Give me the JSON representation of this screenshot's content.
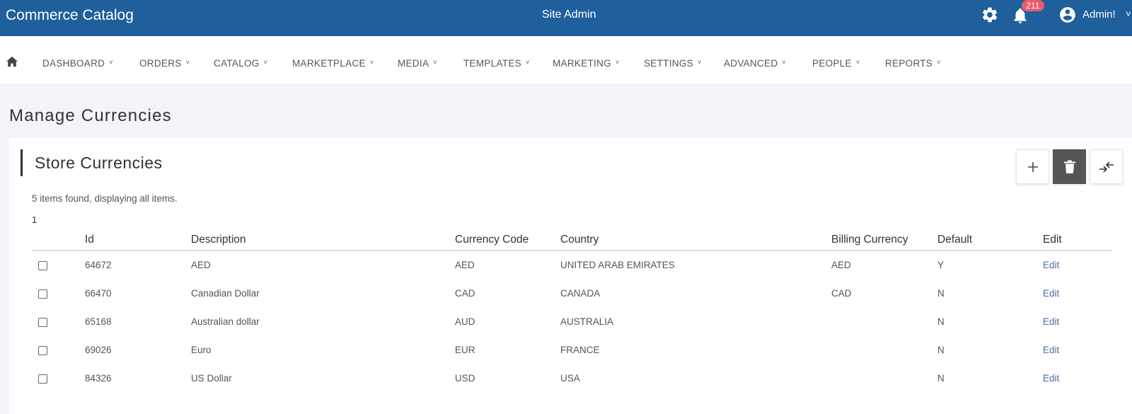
{
  "header": {
    "app_title": "Commerce Catalog",
    "center_title": "Site Admin",
    "notifications_count": "211",
    "user_name": "Admin!",
    "icons": [
      "gear-icon",
      "bell-icon",
      "user-circle-icon",
      "chevron-down-icon"
    ],
    "bg_color": "#1f5f9c",
    "badge_color": "#f05b6a"
  },
  "nav": {
    "home_icon": "home-icon",
    "items": [
      "DASHBOARD",
      "ORDERS",
      "CATALOG",
      "MARKETPLACE",
      "MEDIA",
      "TEMPLATES",
      "MARKETING",
      "SETTINGS",
      "ADVANCED",
      "PEOPLE",
      "REPORTS"
    ],
    "caret": "˅"
  },
  "page": {
    "title": "Manage Currencies"
  },
  "card": {
    "title": "Store Currencies",
    "toolbar_icons": [
      "plus-icon",
      "trash-icon",
      "arrows-swap-icon"
    ],
    "items_found": "5 items found, displaying all items.",
    "page_number": "1"
  },
  "table": {
    "columns": [
      "Id",
      "Description",
      "Currency Code",
      "Country",
      "Billing Currency",
      "Default",
      "Edit"
    ],
    "rows": [
      {
        "id": "64672",
        "description": "AED",
        "code": "AED",
        "country": "UNITED ARAB EMIRATES",
        "billing": "AED",
        "default": "Y",
        "edit": "Edit"
      },
      {
        "id": "66470",
        "description": "Canadian Dollar",
        "code": "CAD",
        "country": "CANADA",
        "billing": "CAD",
        "default": "N",
        "edit": "Edit"
      },
      {
        "id": "65168",
        "description": "Australian dollar",
        "code": "AUD",
        "country": "AUSTRALIA",
        "billing": "",
        "default": "N",
        "edit": "Edit"
      },
      {
        "id": "69026",
        "description": "Euro",
        "code": "EUR",
        "country": "FRANCE",
        "billing": "",
        "default": "N",
        "edit": "Edit"
      },
      {
        "id": "84326",
        "description": "US Dollar",
        "code": "USD",
        "country": "USA",
        "billing": "",
        "default": "N",
        "edit": "Edit"
      }
    ]
  }
}
